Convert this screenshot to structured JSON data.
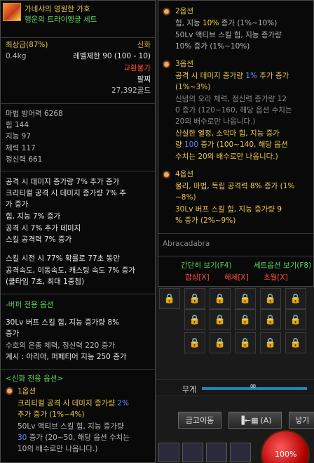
{
  "item": {
    "name": "가네샤의 영원한 가호",
    "set_name": "행운의 트라이앵글 세트",
    "grade": "최상급(87%)",
    "rarity": "신화",
    "weight": "0.4kg",
    "level_req": "레벨제한 90 (100 - 10)",
    "trade": "교환불가",
    "slot_type": "팔찌",
    "price": "27,392골드"
  },
  "stats": {
    "magic_def": "마법 방어력 6268",
    "str": "힘 144",
    "int": "지능 97",
    "vit": "체력 117",
    "spirit": "정신력 661"
  },
  "effects": [
    "공격 시 데미지 증가량 7% 추가 증가",
    "크리티컬 공격 시 데미지 증가량 7% 추",
    "가 증가",
    "힘, 지능 7% 증가",
    "공격 시 7% 추가 데미지",
    "스킬 공격력 7% 증가"
  ],
  "skill_effect": [
    "스킬 시전 시 77% 확률로 77초 동안",
    "공격속도, 이동속도, 캐스팅 속도 7% 증가",
    "(쿨타임 7초, 최대 1중첩)"
  ],
  "buff_section": {
    "title": "-버퍼 전용 옵션",
    "lines": [
      "30Lv 버프 스킬 힘, 지능 증가량 8%",
      "증가",
      "수호의 은총 체력, 정신력 220 증가",
      "계시 : 아리아, 퍼페티어 지능 250 증가"
    ]
  },
  "mythic_section": {
    "title": "<신화 전용 옵션>",
    "option1_title": "1옵션",
    "option1_line1_a": "크리티컬 공격 시 데미지 증가량 ",
    "option1_line1_b": "2%",
    "option1_line2": "추가 증가 (1%~4%)",
    "option1_line3": "50Lv 액티브 스킬 힘, 지능 증가량",
    "option1_line4_a": "30",
    "option1_line4_b": " 증가 (20~50, 해당 옵션 수치는",
    "option1_line5": "10의 배수로만 나옵니다.)"
  },
  "right": {
    "opt2_title": "2옵션",
    "opt2_l1_a": "힘, 지능 ",
    "opt2_l1_b": "10%",
    "opt2_l1_c": " 증가 (1%~10%)",
    "opt2_l2": "50Lv 액티브 스킬 힘, 지능 증가량",
    "opt2_l3": "10% 증가 (1%~10%)",
    "opt3_title": "3옵션",
    "opt3_l1_a": "공격 시 데미지 증가량 ",
    "opt3_l1_b": "1%",
    "opt3_l1_c": " 추가 증가",
    "opt3_l2": "(1%~3%)",
    "opt3_l3": "신념의 오라 체력, 정신력 증가량 12",
    "opt3_l4": "0 증가 (120~160, 해당 옵션 수치는",
    "opt3_l5": "20의 배수로만 나옵니다.)",
    "opt3_l6": "신실한 열정, 소악마 힘, 지능 증가",
    "opt3_l7_a": "량 ",
    "opt3_l7_b": "100",
    "opt3_l7_c": " 증가 (100~140, 해당 옵션",
    "opt3_l8": "수치는 20의 배수로만 나옵니다.)",
    "opt4_title": "4옵션",
    "opt4_l1_a": "물리, 마법, 독립 공격력 ",
    "opt4_l1_b": "8%",
    "opt4_l1_c": " 증가 (1%",
    "opt4_l2": "~8%)",
    "opt4_l3_a": "30Lv 버프 스킬 힘, 지능 증가량 ",
    "opt4_l3_b": "9",
    "opt4_l4_a": "%",
    "opt4_l4_b": " 증가 (2%~9%)",
    "signature": "Abracadabra",
    "simple_view": "간단히 보기(F4)",
    "set_option_view": "세트옵션 보기(F8)",
    "combine": "합성[X]",
    "disassemble": "해체[X]",
    "transcend": "초월[X]"
  },
  "game_ui": {
    "weight_label": "무게",
    "weight_value": "∞",
    "vault_button": "금고이동",
    "arrange_button": "(A)",
    "next_button": "넣기",
    "hp_value": "100%"
  }
}
